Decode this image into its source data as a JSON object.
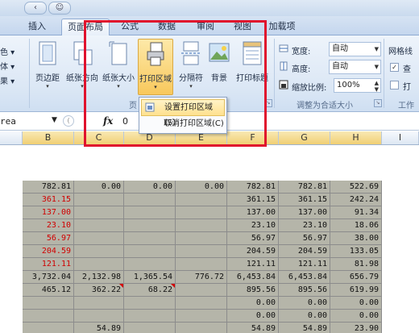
{
  "tabs": [
    {
      "label": "插入"
    },
    {
      "label": "页面布局"
    },
    {
      "label": "公式"
    },
    {
      "label": "数据"
    },
    {
      "label": "审阅"
    },
    {
      "label": "视图"
    },
    {
      "label": "加载项"
    }
  ],
  "ribbon": {
    "left_fragments": [
      "色 ▾",
      "体 ▾",
      "果 ▾"
    ],
    "buttons": [
      {
        "label": "页边距",
        "icon": "margins-icon"
      },
      {
        "label": "纸张方向",
        "icon": "orientation-icon"
      },
      {
        "label": "纸张大小",
        "icon": "paper-size-icon"
      },
      {
        "label": "打印区域",
        "icon": "print-area-icon"
      },
      {
        "label": "分隔符",
        "icon": "breaks-icon"
      },
      {
        "label": "背景",
        "icon": "background-icon"
      },
      {
        "label": "打印标题",
        "icon": "print-titles-icon"
      }
    ],
    "page_setup_group_label": "页",
    "scale": {
      "width_label": "宽度:",
      "width_value": "自动",
      "height_label": "高度:",
      "height_value": "自动",
      "scale_label": "缩放比例:",
      "scale_value": "100%",
      "group_label": "调整为合适大小"
    },
    "sheet_options": {
      "label_top": "网格线",
      "view_label": "查",
      "print_label": "打",
      "view_checked": "✓",
      "group_label": "工作"
    }
  },
  "menu": {
    "items": [
      {
        "label": "设置打印区域(S)",
        "icon": "set-print-area-icon"
      },
      {
        "label": "取消打印区域(C)"
      }
    ]
  },
  "formula_bar": {
    "name_box": "rea",
    "fx": "fx",
    "value": "0"
  },
  "columns": [
    "B",
    "C",
    "D",
    "E",
    "F",
    "G",
    "H",
    "I"
  ],
  "rows": [
    [
      "782.81",
      "0.00",
      "0.00",
      "0.00",
      "782.81",
      "782.81",
      "522.69"
    ],
    [
      "361.15",
      "",
      "",
      "",
      "361.15",
      "361.15",
      "242.24"
    ],
    [
      "137.00",
      "",
      "",
      "",
      "137.00",
      "137.00",
      "91.34"
    ],
    [
      "23.10",
      "",
      "",
      "",
      "23.10",
      "23.10",
      "18.06"
    ],
    [
      "56.97",
      "",
      "",
      "",
      "56.97",
      "56.97",
      "38.00"
    ],
    [
      "204.59",
      "",
      "",
      "",
      "204.59",
      "204.59",
      "133.05"
    ],
    [
      "121.11",
      "",
      "",
      "",
      "121.11",
      "121.11",
      "81.98"
    ],
    [
      "3,732.04",
      "2,132.98",
      "1,365.54",
      "776.72",
      "6,453.84",
      "6,453.84",
      "656.79"
    ],
    [
      "465.12",
      "362.22",
      "68.22",
      "",
      "895.56",
      "895.56",
      "619.99"
    ],
    [
      "",
      "",
      "",
      "",
      "0.00",
      "0.00",
      "0.00"
    ],
    [
      "",
      "",
      "",
      "",
      "0.00",
      "0.00",
      "0.00"
    ],
    [
      "",
      "54.89",
      "",
      "",
      "54.89",
      "54.89",
      "23.90"
    ]
  ],
  "red_rows_col_b": [
    1,
    2,
    3,
    4,
    5,
    6
  ],
  "colors": {
    "highlight_border": "#e0122d",
    "selected_cell_fill": "#b5b5a9",
    "red_text": "#d00000"
  }
}
